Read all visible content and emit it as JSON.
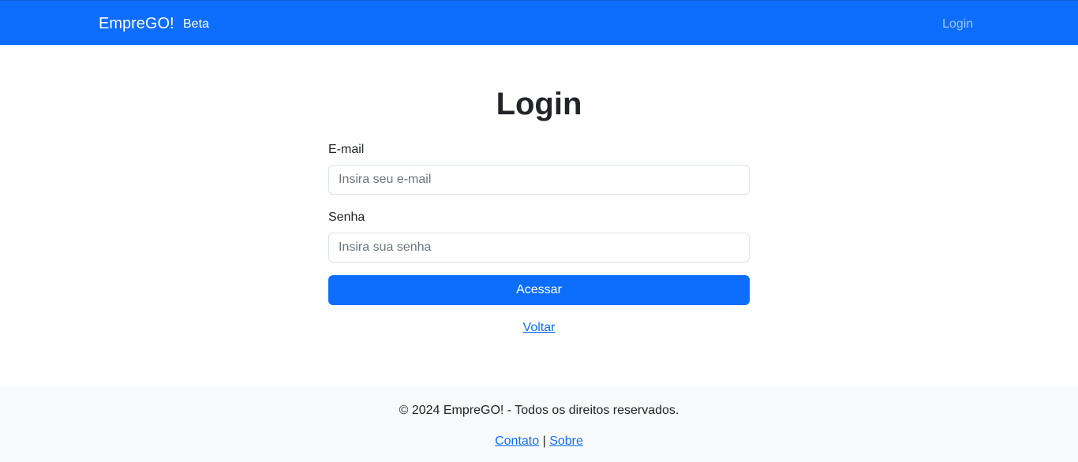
{
  "navbar": {
    "brand": "EmpreGO!",
    "badge": "Beta",
    "login_link": "Login"
  },
  "main": {
    "title": "Login",
    "email": {
      "label": "E-mail",
      "placeholder": "Insira seu e-mail",
      "value": ""
    },
    "password": {
      "label": "Senha",
      "placeholder": "Insira sua senha",
      "value": ""
    },
    "submit_label": "Acessar",
    "back_link": "Voltar"
  },
  "footer": {
    "copyright": "© 2024 EmpreGO! - Todos os direitos reservados.",
    "contact_link": "Contato",
    "separator": "|",
    "about_link": "Sobre"
  },
  "colors": {
    "primary": "#0d6efd",
    "footer_bg": "#f8f9fa",
    "text": "#212529"
  }
}
